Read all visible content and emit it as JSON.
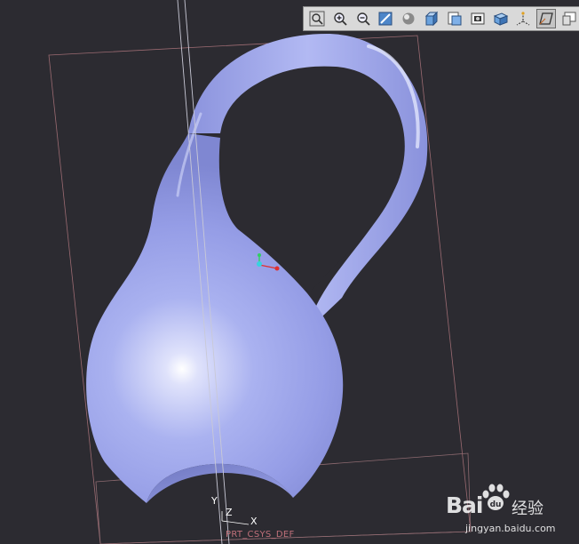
{
  "viewport": {
    "background": "#2c2b31",
    "model_color": "#a6aef0",
    "datum_color": "#b07e84"
  },
  "toolbar": {
    "buttons": [
      {
        "name": "zoom-fit-icon"
      },
      {
        "name": "zoom-in-icon"
      },
      {
        "name": "zoom-out-icon"
      },
      {
        "name": "repaint-icon"
      },
      {
        "name": "shading-icon"
      },
      {
        "name": "saved-views-icon"
      },
      {
        "name": "view-manager-icon"
      },
      {
        "name": "appearance-icon"
      },
      {
        "name": "display-style-icon"
      },
      {
        "name": "datum-display-icon"
      },
      {
        "name": "plane-display-icon"
      },
      {
        "name": "more-icon"
      }
    ]
  },
  "csys": {
    "label": "PRT_CSYS_DEF",
    "axis_x": "X",
    "axis_y": "Y",
    "axis_z": "Z"
  },
  "watermark": {
    "brand": "Bai",
    "cn": "经验",
    "url": "jingyan.baidu.com"
  }
}
